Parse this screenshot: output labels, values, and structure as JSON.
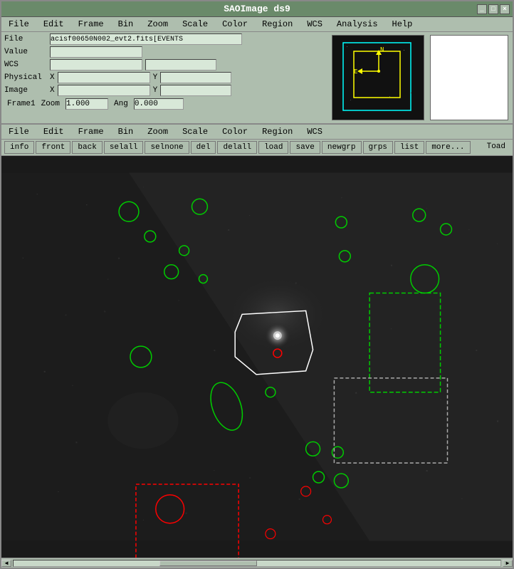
{
  "window": {
    "title": "SAOImage ds9"
  },
  "menubar1": {
    "items": [
      "File",
      "Edit",
      "Frame",
      "Bin",
      "Zoom",
      "Scale",
      "Color",
      "Region",
      "WCS",
      "Analysis",
      "Help"
    ]
  },
  "info_panel": {
    "file_label": "File",
    "file_value": "acisf00650N002_evt2.fits[EVENTS",
    "value_label": "Value",
    "value_value": "",
    "wcs_label": "WCS",
    "wcs_value": "",
    "wcs_value2": "",
    "physical_label": "Physical",
    "physical_x_label": "X",
    "physical_x_value": "",
    "physical_y_label": "Y",
    "physical_y_value": "",
    "image_label": "Image",
    "image_x_label": "X",
    "image_x_value": "",
    "image_y_label": "Y",
    "image_y_value": "",
    "frame_label": "Frame1",
    "zoom_label": "Zoom",
    "zoom_value": "1.000",
    "ang_label": "Ang",
    "ang_value": "0.000"
  },
  "menubar2": {
    "items": [
      "File",
      "Edit",
      "Frame",
      "Bin",
      "Zoom",
      "Scale",
      "Color",
      "Region",
      "WCS"
    ]
  },
  "region_toolbar": {
    "items": [
      "info",
      "front",
      "back",
      "selall",
      "selnone",
      "del",
      "delall",
      "load",
      "save",
      "newgrp",
      "grps",
      "list",
      "more..."
    ]
  },
  "toad_label": "Toad"
}
